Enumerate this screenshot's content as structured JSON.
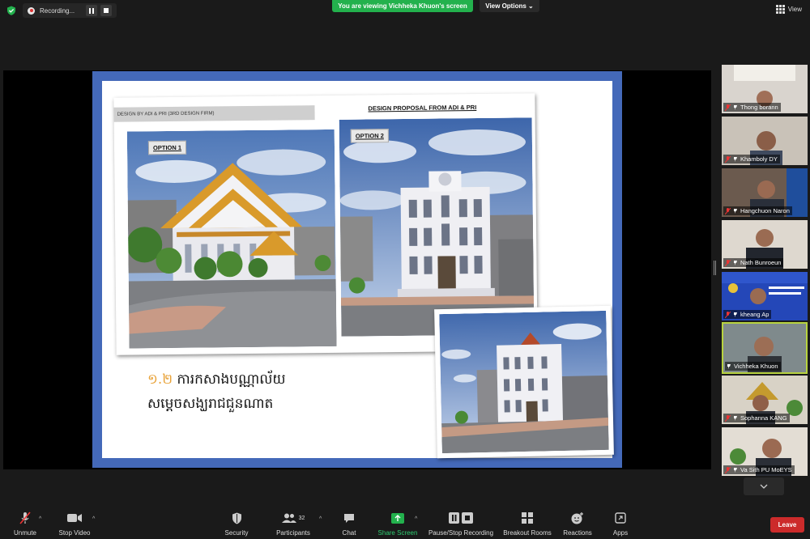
{
  "top": {
    "recording_label": "Recording...",
    "viewing_banner": "You are viewing Vichheka Khuon's screen",
    "view_options": "View Options",
    "view_label": "View",
    "colors": {
      "viewing_banner_bg": "#23b14d",
      "leave_bg": "#cc2b2b"
    }
  },
  "slide": {
    "header_left": "DESIGN  BY  ADI & PRI  (3RD DESIGN FIRM)",
    "proposal_title": "DESIGN PROPOSAL FROM ADI & PRI",
    "option1": "OPTION 1",
    "option2": "OPTION 2",
    "khmer_number": "១.២",
    "khmer_line1": "ការកសាងបណ្ណាល័យ",
    "khmer_line2": "សម្តេចសង្ឃរាជជួនណាត",
    "frame_color": "#4469b9"
  },
  "participants": [
    {
      "name": "Thong borann",
      "muted": true,
      "active": false
    },
    {
      "name": "Khamboly DY",
      "muted": true,
      "active": false
    },
    {
      "name": "Hangchuon Naron",
      "muted": true,
      "active": false
    },
    {
      "name": "Nath Bunroeun",
      "muted": true,
      "active": false
    },
    {
      "name": "kheang Ap",
      "muted": true,
      "active": false
    },
    {
      "name": "Vichheka Khuon",
      "muted": false,
      "active": true
    },
    {
      "name": "Sophanna KANG",
      "muted": true,
      "active": false
    },
    {
      "name": "Va Sith PU MoEYS",
      "muted": true,
      "active": false
    }
  ],
  "toolbar": {
    "unmute": "Unmute",
    "stop_video": "Stop Video",
    "security": "Security",
    "participants": "Participants",
    "participants_count": "32",
    "chat": "Chat",
    "share_screen": "Share Screen",
    "pause_stop_recording": "Pause/Stop Recording",
    "breakout_rooms": "Breakout Rooms",
    "reactions": "Reactions",
    "apps": "Apps",
    "leave": "Leave"
  }
}
